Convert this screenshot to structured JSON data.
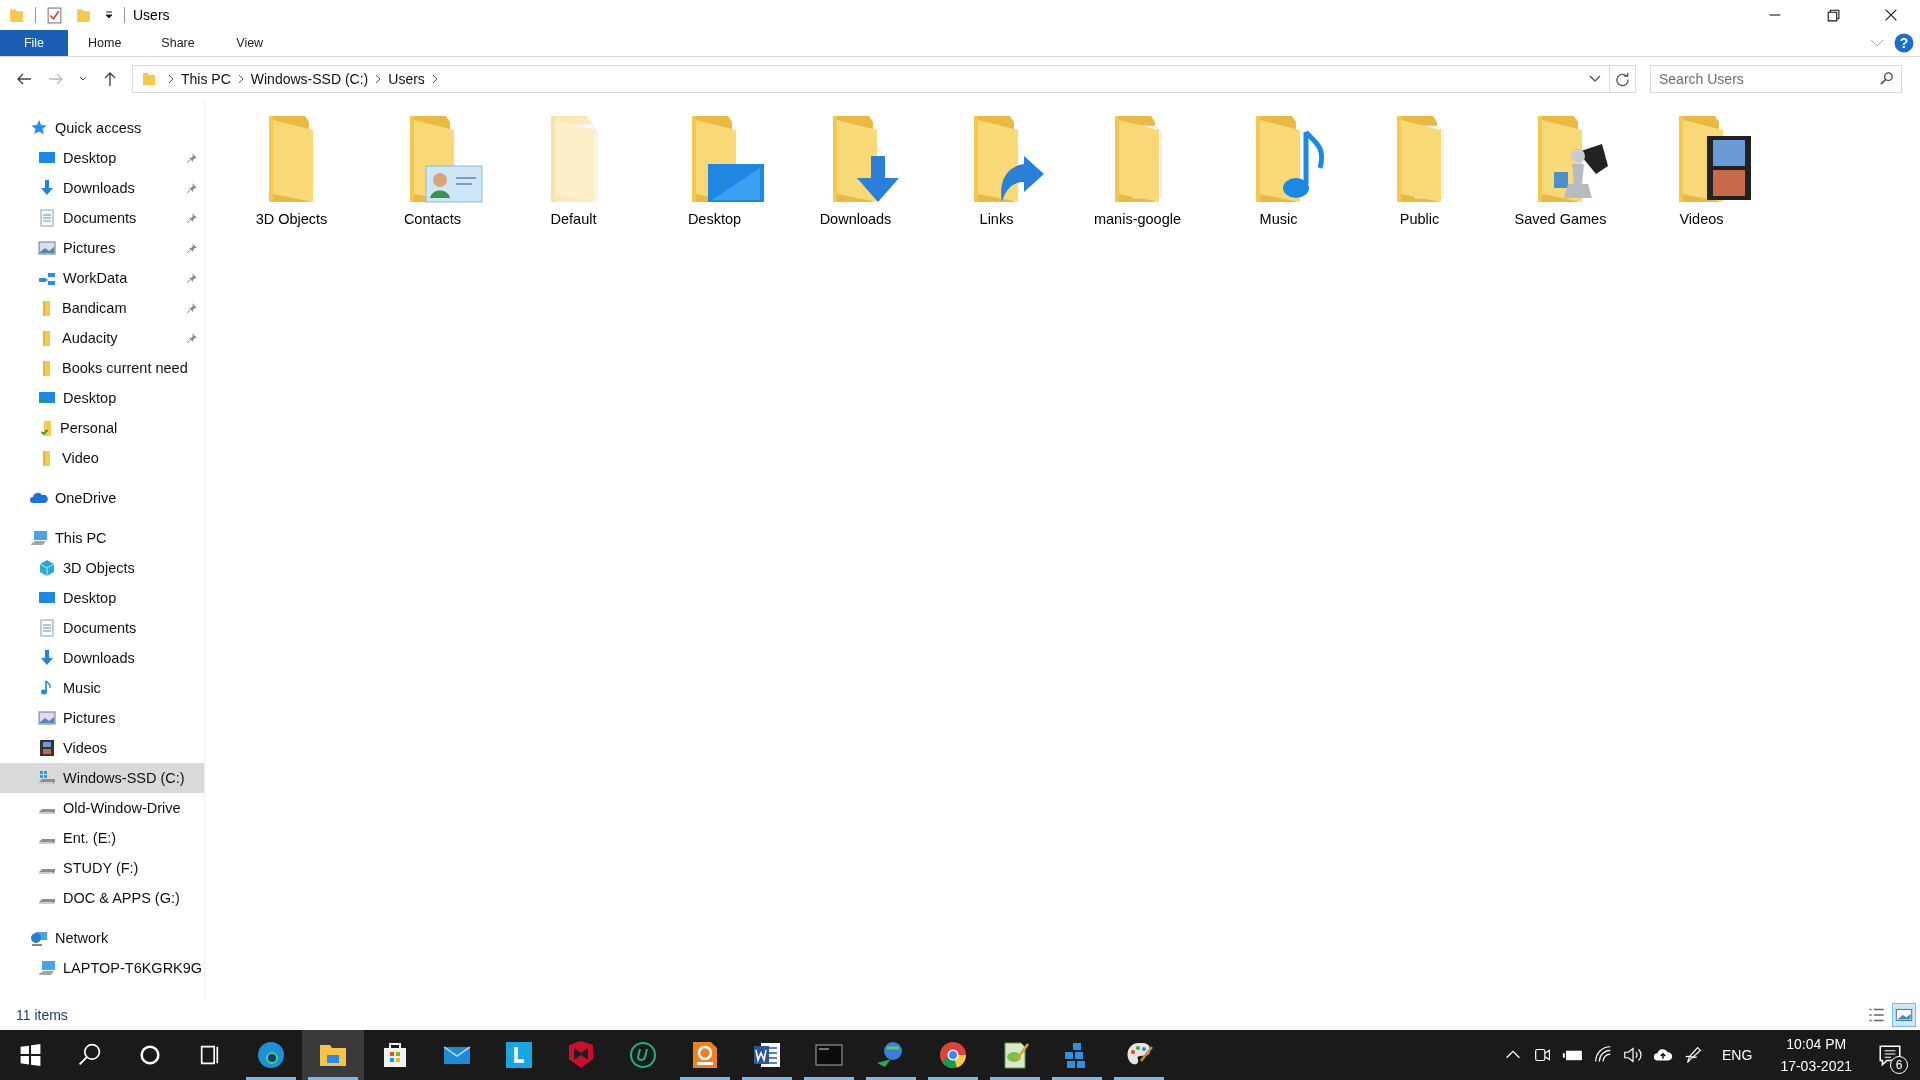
{
  "window": {
    "title": "Users"
  },
  "help": "?",
  "ribbon_tabs": [
    {
      "label": "File",
      "kind": "file"
    },
    {
      "label": "Home",
      "kind": "tab"
    },
    {
      "label": "Share",
      "kind": "tab"
    },
    {
      "label": "View",
      "kind": "tab"
    }
  ],
  "address": {
    "crumbs": [
      "This PC",
      "Windows-SSD (C:)",
      "Users"
    ]
  },
  "search": {
    "placeholder": "Search Users"
  },
  "nav": [
    {
      "label": "Quick access",
      "kind": "star",
      "selected": false,
      "children": [
        {
          "label": "Desktop",
          "kind": "monitor",
          "pinned": true,
          "selected": false
        },
        {
          "label": "Downloads",
          "kind": "download",
          "pinned": true,
          "selected": false
        },
        {
          "label": "Documents",
          "kind": "doc",
          "pinned": true,
          "selected": false
        },
        {
          "label": "Pictures",
          "kind": "picture",
          "pinned": true,
          "selected": false
        },
        {
          "label": "WorkData",
          "kind": "network",
          "pinned": true,
          "selected": false
        },
        {
          "label": "Bandicam",
          "kind": "folder",
          "pinned": true,
          "selected": false
        },
        {
          "label": "Audacity",
          "kind": "folder",
          "pinned": true,
          "selected": false
        },
        {
          "label": "Books current need",
          "kind": "folder",
          "pinned": false,
          "selected": false
        },
        {
          "label": "Desktop",
          "kind": "monitor-synced",
          "pinned": false,
          "selected": false
        },
        {
          "label": "Personal",
          "kind": "folder-synced",
          "pinned": false,
          "selected": false
        },
        {
          "label": "Video",
          "kind": "folder",
          "pinned": false,
          "selected": false
        }
      ]
    },
    {
      "label": "OneDrive",
      "kind": "cloud",
      "selected": false
    },
    {
      "label": "This PC",
      "kind": "pc",
      "selected": false,
      "children": [
        {
          "label": "3D Objects",
          "kind": "cube",
          "pinned": false,
          "selected": false
        },
        {
          "label": "Desktop",
          "kind": "monitor",
          "pinned": false,
          "selected": false
        },
        {
          "label": "Documents",
          "kind": "doc",
          "pinned": false,
          "selected": false
        },
        {
          "label": "Downloads",
          "kind": "download",
          "pinned": false,
          "selected": false
        },
        {
          "label": "Music",
          "kind": "music",
          "pinned": false,
          "selected": false
        },
        {
          "label": "Pictures",
          "kind": "picture",
          "pinned": false,
          "selected": false
        },
        {
          "label": "Videos",
          "kind": "video",
          "pinned": false,
          "selected": false
        },
        {
          "label": "Windows-SSD (C:)",
          "kind": "drive-win",
          "pinned": false,
          "selected": true
        },
        {
          "label": "Old-Window-Drive",
          "kind": "drive",
          "pinned": false,
          "selected": false
        },
        {
          "label": "Ent. (E:)",
          "kind": "drive",
          "pinned": false,
          "selected": false
        },
        {
          "label": "STUDY (F:)",
          "kind": "drive",
          "pinned": false,
          "selected": false
        },
        {
          "label": "DOC & APPS (G:)",
          "kind": "drive",
          "pinned": false,
          "selected": false
        }
      ]
    },
    {
      "label": "Network",
      "kind": "globe",
      "selected": false,
      "children": [
        {
          "label": "LAPTOP-T6KGRK9G",
          "kind": "pc",
          "pinned": false,
          "selected": false
        }
      ]
    }
  ],
  "folders": [
    {
      "name": "3D Objects",
      "kind": "plain"
    },
    {
      "name": "Contacts",
      "kind": "contacts"
    },
    {
      "name": "Default",
      "kind": "faded"
    },
    {
      "name": "Desktop",
      "kind": "desktop"
    },
    {
      "name": "Downloads",
      "kind": "downloads"
    },
    {
      "name": "Links",
      "kind": "links"
    },
    {
      "name": "manis-google",
      "kind": "papers"
    },
    {
      "name": "Music",
      "kind": "music"
    },
    {
      "name": "Public",
      "kind": "papers"
    },
    {
      "name": "Saved Games",
      "kind": "games"
    },
    {
      "name": "Videos",
      "kind": "videos"
    }
  ],
  "status_bar": {
    "count": "11 items",
    "views": [
      {
        "kind": "details",
        "selected": false
      },
      {
        "kind": "large",
        "selected": true
      }
    ]
  },
  "taskbar": {
    "apps": [
      {
        "kind": "edge",
        "running": true,
        "selected": false
      },
      {
        "kind": "explorer",
        "running": true,
        "selected": true
      },
      {
        "kind": "store",
        "running": false,
        "selected": false
      },
      {
        "kind": "mail",
        "running": false,
        "selected": false
      },
      {
        "kind": "letter",
        "running": false,
        "selected": false
      },
      {
        "kind": "shield",
        "running": false,
        "selected": false
      },
      {
        "kind": "ucircle",
        "running": false,
        "selected": false
      },
      {
        "kind": "pdf",
        "running": true,
        "selected": false
      },
      {
        "kind": "word",
        "running": true,
        "selected": false
      },
      {
        "kind": "terminal",
        "running": true,
        "selected": false
      },
      {
        "kind": "globe",
        "running": true,
        "selected": false
      },
      {
        "kind": "chrome",
        "running": true,
        "selected": false
      },
      {
        "kind": "editor",
        "running": true,
        "selected": false
      },
      {
        "kind": "cubes",
        "running": true,
        "selected": false
      },
      {
        "kind": "palette",
        "running": true,
        "selected": false
      }
    ],
    "language": "ENG",
    "time": "10:04 PM",
    "date": "17-03-2021",
    "notifications": "6"
  }
}
